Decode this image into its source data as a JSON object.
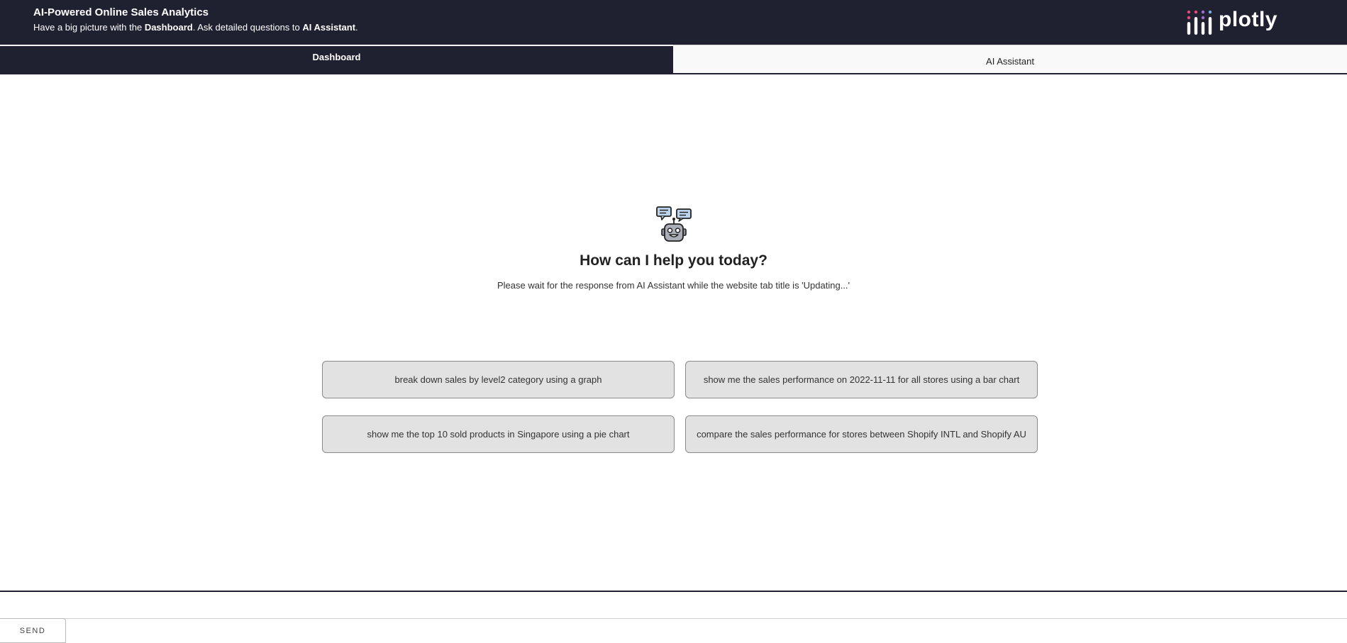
{
  "header": {
    "title": "AI-Powered Online Sales Analytics",
    "subtitle_prefix": "Have a big picture with the ",
    "subtitle_dashboard": "Dashboard",
    "subtitle_middle": ". Ask detailed questions to ",
    "subtitle_assistant": "AI Assistant",
    "subtitle_suffix": ".",
    "logo_text": "plotly"
  },
  "tabs": [
    {
      "label": "Dashboard",
      "active": true
    },
    {
      "label": "AI Assistant",
      "active": false
    }
  ],
  "welcome": {
    "icon": "robot-chat-icon",
    "title": "How can I help you today?",
    "note": "Please wait for the response from AI Assistant while the website tab title is 'Updating...'"
  },
  "suggestions": [
    "break down sales by level2 category using a graph",
    "show me the sales performance on 2022-11-11 for all stores using a bar chart",
    "show me the top 10 sold products in Singapore using a pie chart",
    "compare the sales performance for stores between Shopify INTL and Shopify AU"
  ],
  "chat": {
    "input_value": "",
    "send_label": "SEND"
  },
  "colors": {
    "header_bg": "#1f2130",
    "suggestion_bg": "#e2e2e2",
    "logo_dot_pink": "#e8497a",
    "logo_dot_purple": "#9d6cd4",
    "logo_dot_blue": "#7aa8e8"
  }
}
